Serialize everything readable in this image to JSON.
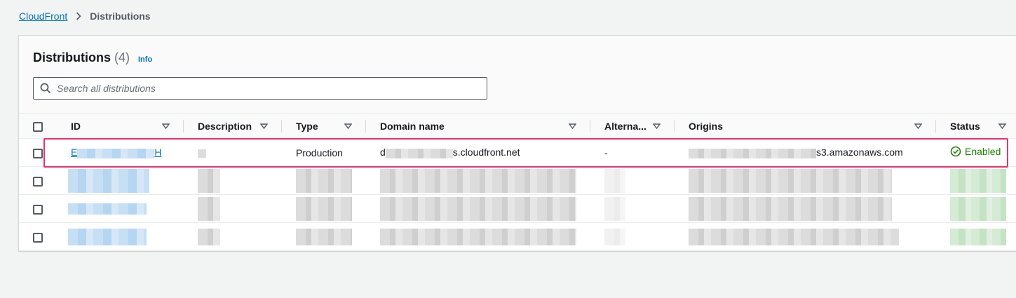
{
  "breadcrumb": {
    "root": "CloudFront",
    "current": "Distributions"
  },
  "panel": {
    "title": "Distributions",
    "count": "(4)",
    "info": "Info"
  },
  "search": {
    "placeholder": "Search all distributions"
  },
  "table": {
    "columns": {
      "id": "ID",
      "description": "Description",
      "type": "Type",
      "domain": "Domain name",
      "alternate": "Alterna...",
      "origins": "Origins",
      "status": "Status"
    },
    "rows": [
      {
        "id_prefix": "E",
        "id_suffix": "H",
        "type": "Production",
        "domain_prefix": "d",
        "domain_suffix": "s.cloudfront.net",
        "alternate": "-",
        "origin_suffix": "s3.amazonaws.com",
        "status": "Enabled"
      }
    ]
  },
  "colors": {
    "link": "#0073bb",
    "status_enabled": "#1d8102",
    "highlight": "#e8336d"
  }
}
